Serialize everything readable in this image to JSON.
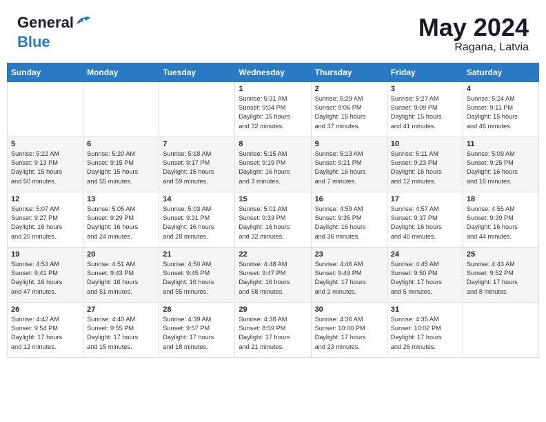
{
  "logo": {
    "line1": "General",
    "line2": "Blue"
  },
  "title": {
    "month_year": "May 2024",
    "location": "Ragana, Latvia"
  },
  "days_of_week": [
    "Sunday",
    "Monday",
    "Tuesday",
    "Wednesday",
    "Thursday",
    "Friday",
    "Saturday"
  ],
  "weeks": [
    [
      {
        "day": "",
        "info": ""
      },
      {
        "day": "",
        "info": ""
      },
      {
        "day": "",
        "info": ""
      },
      {
        "day": "1",
        "info": "Sunrise: 5:31 AM\nSunset: 9:04 PM\nDaylight: 15 hours\nand 32 minutes."
      },
      {
        "day": "2",
        "info": "Sunrise: 5:29 AM\nSunset: 9:06 PM\nDaylight: 15 hours\nand 37 minutes."
      },
      {
        "day": "3",
        "info": "Sunrise: 5:27 AM\nSunset: 9:09 PM\nDaylight: 15 hours\nand 41 minutes."
      },
      {
        "day": "4",
        "info": "Sunrise: 5:24 AM\nSunset: 9:11 PM\nDaylight: 15 hours\nand 46 minutes."
      }
    ],
    [
      {
        "day": "5",
        "info": "Sunrise: 5:22 AM\nSunset: 9:13 PM\nDaylight: 15 hours\nand 50 minutes."
      },
      {
        "day": "6",
        "info": "Sunrise: 5:20 AM\nSunset: 9:15 PM\nDaylight: 15 hours\nand 55 minutes."
      },
      {
        "day": "7",
        "info": "Sunrise: 5:18 AM\nSunset: 9:17 PM\nDaylight: 15 hours\nand 59 minutes."
      },
      {
        "day": "8",
        "info": "Sunrise: 5:15 AM\nSunset: 9:19 PM\nDaylight: 16 hours\nand 3 minutes."
      },
      {
        "day": "9",
        "info": "Sunrise: 5:13 AM\nSunset: 9:21 PM\nDaylight: 16 hours\nand 7 minutes."
      },
      {
        "day": "10",
        "info": "Sunrise: 5:11 AM\nSunset: 9:23 PM\nDaylight: 16 hours\nand 12 minutes."
      },
      {
        "day": "11",
        "info": "Sunrise: 5:09 AM\nSunset: 9:25 PM\nDaylight: 16 hours\nand 16 minutes."
      }
    ],
    [
      {
        "day": "12",
        "info": "Sunrise: 5:07 AM\nSunset: 9:27 PM\nDaylight: 16 hours\nand 20 minutes."
      },
      {
        "day": "13",
        "info": "Sunrise: 5:05 AM\nSunset: 9:29 PM\nDaylight: 16 hours\nand 24 minutes."
      },
      {
        "day": "14",
        "info": "Sunrise: 5:03 AM\nSunset: 9:31 PM\nDaylight: 16 hours\nand 28 minutes."
      },
      {
        "day": "15",
        "info": "Sunrise: 5:01 AM\nSunset: 9:33 PM\nDaylight: 16 hours\nand 32 minutes."
      },
      {
        "day": "16",
        "info": "Sunrise: 4:59 AM\nSunset: 9:35 PM\nDaylight: 16 hours\nand 36 minutes."
      },
      {
        "day": "17",
        "info": "Sunrise: 4:57 AM\nSunset: 9:37 PM\nDaylight: 16 hours\nand 40 minutes."
      },
      {
        "day": "18",
        "info": "Sunrise: 4:55 AM\nSunset: 9:39 PM\nDaylight: 16 hours\nand 44 minutes."
      }
    ],
    [
      {
        "day": "19",
        "info": "Sunrise: 4:53 AM\nSunset: 9:41 PM\nDaylight: 16 hours\nand 47 minutes."
      },
      {
        "day": "20",
        "info": "Sunrise: 4:51 AM\nSunset: 9:43 PM\nDaylight: 16 hours\nand 51 minutes."
      },
      {
        "day": "21",
        "info": "Sunrise: 4:50 AM\nSunset: 9:45 PM\nDaylight: 16 hours\nand 55 minutes."
      },
      {
        "day": "22",
        "info": "Sunrise: 4:48 AM\nSunset: 9:47 PM\nDaylight: 16 hours\nand 58 minutes."
      },
      {
        "day": "23",
        "info": "Sunrise: 4:46 AM\nSunset: 9:49 PM\nDaylight: 17 hours\nand 2 minutes."
      },
      {
        "day": "24",
        "info": "Sunrise: 4:45 AM\nSunset: 9:50 PM\nDaylight: 17 hours\nand 5 minutes."
      },
      {
        "day": "25",
        "info": "Sunrise: 4:43 AM\nSunset: 9:52 PM\nDaylight: 17 hours\nand 8 minutes."
      }
    ],
    [
      {
        "day": "26",
        "info": "Sunrise: 4:42 AM\nSunset: 9:54 PM\nDaylight: 17 hours\nand 12 minutes."
      },
      {
        "day": "27",
        "info": "Sunrise: 4:40 AM\nSunset: 9:55 PM\nDaylight: 17 hours\nand 15 minutes."
      },
      {
        "day": "28",
        "info": "Sunrise: 4:39 AM\nSunset: 9:57 PM\nDaylight: 17 hours\nand 18 minutes."
      },
      {
        "day": "29",
        "info": "Sunrise: 4:38 AM\nSunset: 8:59 PM\nDaylight: 17 hours\nand 21 minutes."
      },
      {
        "day": "30",
        "info": "Sunrise: 4:36 AM\nSunset: 10:00 PM\nDaylight: 17 hours\nand 23 minutes."
      },
      {
        "day": "31",
        "info": "Sunrise: 4:35 AM\nSunset: 10:02 PM\nDaylight: 17 hours\nand 26 minutes."
      },
      {
        "day": "",
        "info": ""
      }
    ]
  ]
}
